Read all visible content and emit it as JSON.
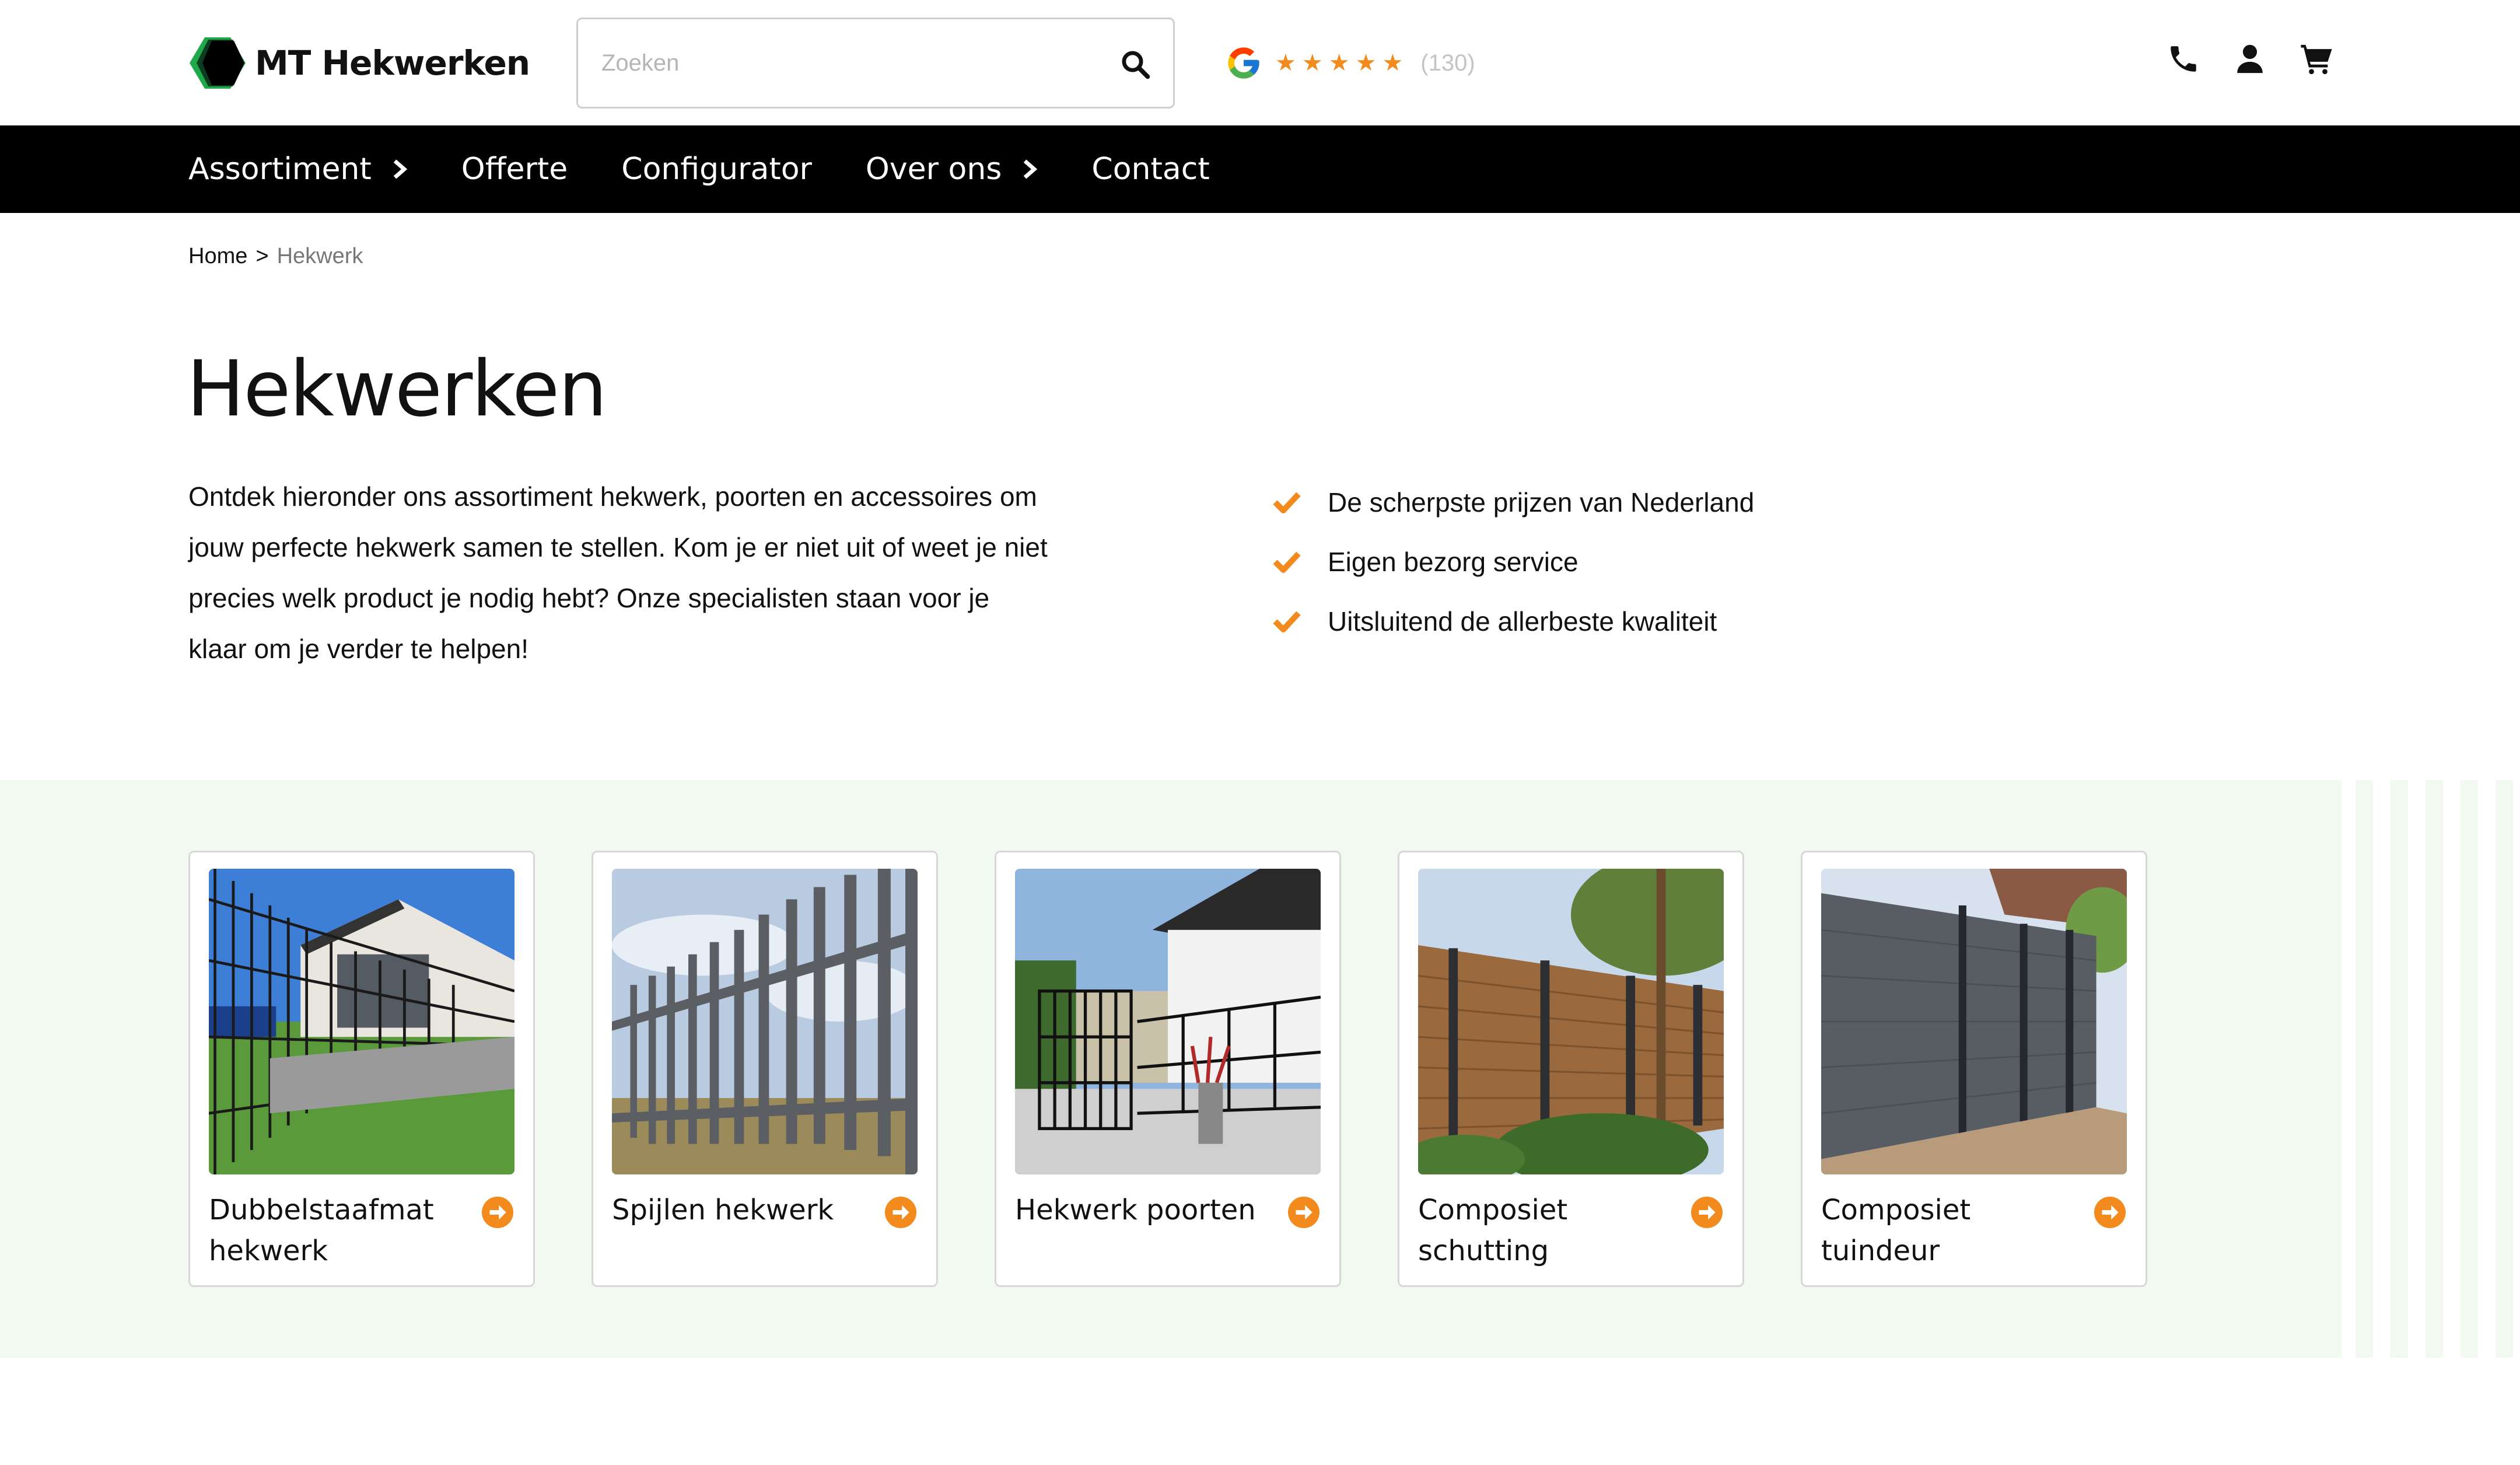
{
  "header": {
    "logo_text": "MT Hekwerken",
    "search": {
      "placeholder": "Zoeken",
      "value": ""
    },
    "rating": {
      "stars": 5,
      "count": "(130)"
    },
    "icons": [
      "phone-icon",
      "user-icon",
      "cart-icon"
    ]
  },
  "nav": {
    "items": [
      {
        "label": "Assortiment",
        "has_submenu": true
      },
      {
        "label": "Offerte",
        "has_submenu": false
      },
      {
        "label": "Configurator",
        "has_submenu": false
      },
      {
        "label": "Over ons",
        "has_submenu": true
      },
      {
        "label": "Contact",
        "has_submenu": false
      }
    ]
  },
  "breadcrumb": {
    "home": "Home",
    "separator": ">",
    "current": "Hekwerk"
  },
  "main": {
    "title": "Hekwerken",
    "intro": "Ontdek hieronder ons assortiment hekwerk, poorten en accessoires om jouw perfecte hekwerk samen te stellen. Kom je er niet uit of weet je niet precies welk product je nodig hebt? Onze specialisten staan voor je klaar om je verder te helpen!",
    "usps": [
      "De scherpste prijzen van Nederland",
      "Eigen bezorg service",
      "Uitsluitend de allerbeste kwaliteit"
    ]
  },
  "categories": [
    {
      "label": "Dubbelstaafmat hekwerk"
    },
    {
      "label": "Spijlen hekwerk"
    },
    {
      "label": "Hekwerk poorten"
    },
    {
      "label": "Composiet schutting"
    },
    {
      "label": "Composiet tuindeur"
    }
  ],
  "colors": {
    "accent_orange": "#f28a1d",
    "nav_background": "#000000",
    "band_background": "#f1f9f1",
    "logo_green": "#1fa84a"
  }
}
